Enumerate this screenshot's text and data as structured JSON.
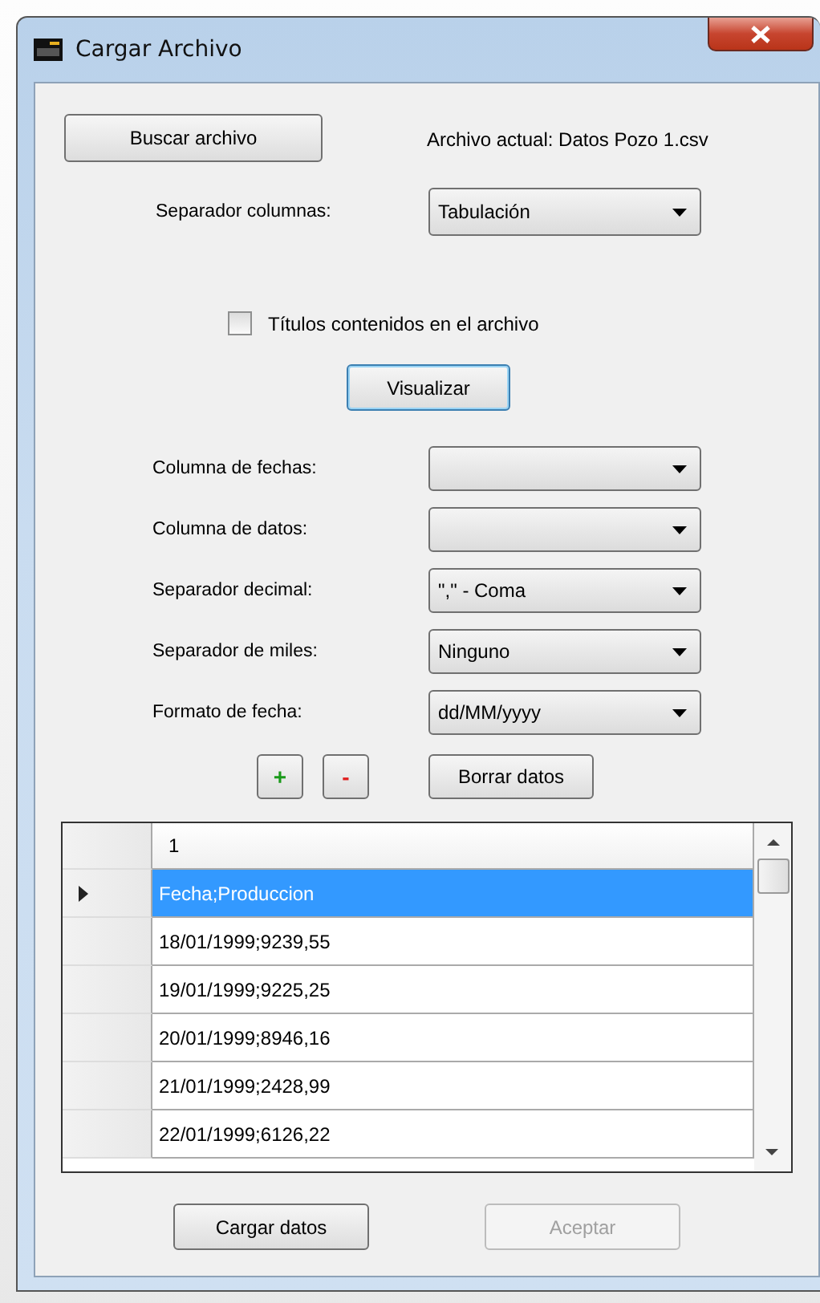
{
  "window": {
    "title": "Cargar Archivo"
  },
  "browse_button": "Buscar archivo",
  "current_file": "Archivo actual: Datos Pozo 1.csv",
  "column_separator": {
    "label": "Separador columnas:",
    "value": "Tabulación"
  },
  "titles_checkbox": {
    "label": "Títulos contenidos en el archivo",
    "checked": false
  },
  "preview_button": "Visualizar",
  "settings": [
    {
      "label": "Columna de fechas:"
    },
    {
      "label": "Columna de datos:"
    },
    {
      "label": "Separador decimal:",
      "value": "\",\" - Coma"
    },
    {
      "label": "Separador de miles:",
      "value": "Ninguno"
    },
    {
      "label": "Formato de fecha:",
      "value": "dd/MM/yyyy"
    }
  ],
  "add_button": "+",
  "remove_button": "-",
  "clear_button": "Borrar datos",
  "table": {
    "columns": [
      "1"
    ],
    "rows": [
      {
        "cells": [
          "Fecha;Produccion"
        ],
        "selected": true
      },
      {
        "cells": [
          "18/01/1999;9239,55"
        ],
        "selected": false
      },
      {
        "cells": [
          "19/01/1999;9225,25"
        ],
        "selected": false
      },
      {
        "cells": [
          "20/01/1999;8946,16"
        ],
        "selected": false
      },
      {
        "cells": [
          "21/01/1999;2428,99"
        ],
        "selected": false
      },
      {
        "cells": [
          "22/01/1999;6126,22"
        ],
        "selected": false
      }
    ]
  },
  "load_button": "Cargar datos",
  "accept_button": {
    "label": "Aceptar",
    "disabled": true
  }
}
